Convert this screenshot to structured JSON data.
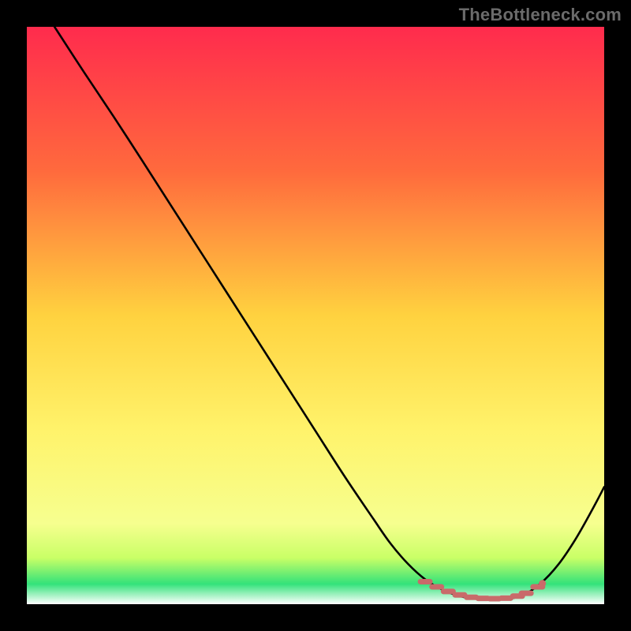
{
  "watermark": {
    "text": "TheBottleneck.com"
  },
  "chart_data": {
    "type": "line",
    "title": "",
    "xlabel": "",
    "ylabel": "",
    "xlim": [
      0,
      100
    ],
    "ylim": [
      0,
      100
    ],
    "grid": false,
    "legend": false,
    "gradient_stops": [
      {
        "offset": 0.0,
        "color": "#ff2b4d"
      },
      {
        "offset": 0.25,
        "color": "#ff6a3d"
      },
      {
        "offset": 0.5,
        "color": "#ffd23f"
      },
      {
        "offset": 0.7,
        "color": "#fff36b"
      },
      {
        "offset": 0.86,
        "color": "#f6ff8f"
      },
      {
        "offset": 0.92,
        "color": "#c9ff66"
      },
      {
        "offset": 0.965,
        "color": "#33e27a"
      },
      {
        "offset": 1.0,
        "color": "#ffffff"
      }
    ],
    "series": [
      {
        "name": "bottleneck-curve",
        "x": [
          4.8,
          10,
          15,
          20,
          25,
          30,
          35,
          40,
          45,
          50,
          55,
          60,
          63,
          66,
          69,
          72,
          75,
          78,
          80,
          83,
          86,
          89,
          92,
          95,
          98,
          100
        ],
        "y": [
          100,
          92,
          84.5,
          76.8,
          69,
          61.2,
          53.4,
          45.6,
          37.8,
          30,
          22.2,
          14.8,
          10.5,
          7.0,
          4.3,
          2.5,
          1.4,
          0.9,
          0.8,
          0.9,
          1.6,
          3.6,
          6.8,
          11.2,
          16.5,
          20.3
        ]
      }
    ],
    "flat_region_markers": {
      "name": "optimal-range",
      "color": "#c96a6a",
      "x": [
        69,
        71,
        73,
        75,
        77,
        79,
        81,
        83,
        85,
        86.5,
        88.5
      ],
      "y": [
        3.9,
        3.0,
        2.2,
        1.6,
        1.2,
        1.0,
        0.95,
        1.05,
        1.4,
        1.9,
        3.0
      ]
    }
  }
}
